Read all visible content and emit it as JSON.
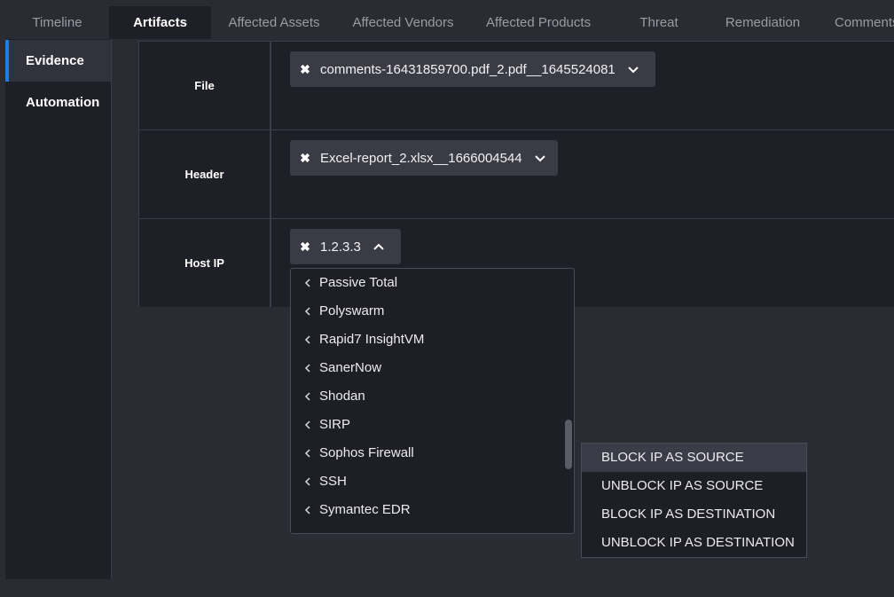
{
  "tabs": [
    "Timeline",
    "Artifacts",
    "Affected Assets",
    "Affected Vendors",
    "Affected Products",
    "Threat",
    "Remediation",
    "Comments"
  ],
  "active_tab": "Artifacts",
  "left_nav": {
    "items": [
      "Evidence",
      "Automation"
    ],
    "active": "Evidence"
  },
  "rows": [
    {
      "label": "File",
      "chip": "comments-16431859700.pdf_2.pdf__1645524081"
    },
    {
      "label": "Header",
      "chip": "Excel-report_2.xlsx__1666004544"
    },
    {
      "label": "Host IP",
      "chip": "1.2.3.3"
    }
  ],
  "integrations": [
    "Passive Total",
    "Polyswarm",
    "Rapid7 InsightVM",
    "SanerNow",
    "Shodan",
    "SIRP",
    "Sophos Firewall",
    "SSH",
    "Symantec EDR"
  ],
  "actions": [
    "BLOCK IP AS SOURCE",
    "UNBLOCK IP AS SOURCE",
    "BLOCK IP AS DESTINATION",
    "UNBLOCK IP AS DESTINATION"
  ],
  "highlighted_action": "BLOCK IP AS SOURCE",
  "colors": {
    "accent": "#1e7ee6",
    "chip_bg": "#3a3b45",
    "panel_bg": "#1f2027"
  }
}
